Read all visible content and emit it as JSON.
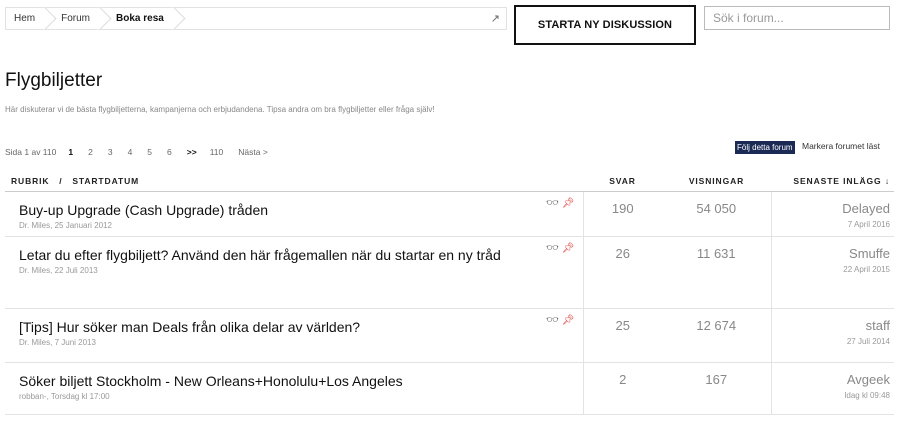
{
  "breadcrumb": [
    {
      "label": "Hem"
    },
    {
      "label": "Forum"
    },
    {
      "label": "Boka resa"
    }
  ],
  "breadcrumb_jump_icon": "↗",
  "new_discussion_label": "STARTA NY DISKUSSION",
  "search": {
    "placeholder": "Sök i forum..."
  },
  "forum": {
    "title": "Flygbiljetter",
    "description": "Här diskuterar vi de bästa flygbiljetterna, kampanjerna och erbjudandena. Tipsa andra om bra flygbiljetter eller fråga själv!"
  },
  "pagination": {
    "info": "Sida 1 av 110",
    "pages": [
      "1",
      "2",
      "3",
      "4",
      "5",
      "6"
    ],
    "active_page": "1",
    "jump": ">>",
    "last": "110",
    "next": "Nästa >"
  },
  "actions": {
    "follow": "Följ detta forum",
    "mark_read": "Markera forumet läst"
  },
  "columns": {
    "subject": "RUBRIK",
    "divider": "/",
    "start_date": "STARTDATUM",
    "replies": "SVAR",
    "views": "VISNINGAR",
    "last_post": "SENASTE INLÄGG",
    "sort_arrow": "↓"
  },
  "threads": [
    {
      "title": "Buy-up Upgrade (Cash Upgrade) tråden",
      "author": "Dr. Miles",
      "started": "25 Januari 2012",
      "replies": "190",
      "views": "54 050",
      "last_user": "Delayed",
      "last_time": "7 April 2016",
      "sticky": true,
      "watched": true
    },
    {
      "title": "Letar du efter flygbiljett? Använd den här frågemallen när du startar en ny tråd",
      "author": "Dr. Miles",
      "started": "22 Juli 2013",
      "replies": "26",
      "views": "11 631",
      "last_user": "Smuffe",
      "last_time": "22 April 2015",
      "sticky": true,
      "watched": true
    },
    {
      "title": "[Tips] Hur söker man Deals från olika delar av världen?",
      "author": "Dr. Miles",
      "started": "7 Juni 2013",
      "replies": "25",
      "views": "12 674",
      "last_user": "staff",
      "last_time": "27 Juli 2014",
      "sticky": true,
      "watched": true
    },
    {
      "title": "Söker biljett Stockholm - New Orleans+Honolulu+Los Angeles",
      "author": "robban-",
      "started": "Torsdag kl 17:00",
      "replies": "2",
      "views": "167",
      "last_user": "Avgeek",
      "last_time": "Idag kl 09:48",
      "sticky": false,
      "watched": false
    }
  ],
  "icons": {
    "watched": "glasses-icon",
    "sticky": "pin-icon"
  },
  "colors": {
    "follow_bg": "#1a2a55",
    "pin": "#dd2222"
  }
}
